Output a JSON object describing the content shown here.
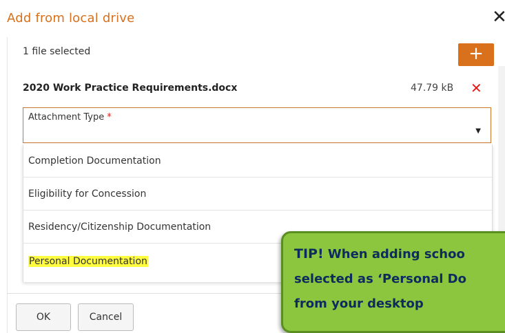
{
  "dialog": {
    "title": "Add from local drive",
    "close_glyph": "✕",
    "file_count": "1 file selected",
    "add_glyph": "+",
    "file": {
      "name": "2020 Work Practice Requirements.docx",
      "size": "47.79 kB",
      "remove_glyph": "✕"
    },
    "attachment_type": {
      "label": "Attachment Type",
      "required_mark": "*",
      "caret": "▼"
    },
    "options": [
      "Completion Documentation",
      "Eligibility for Concession",
      "Residency/Citizenship Documentation",
      "Personal Documentation"
    ],
    "buttons": {
      "ok": "OK",
      "cancel": "Cancel"
    }
  },
  "tip": {
    "prefix": "TIP!",
    "line1": "When adding schoo",
    "line2": "selected as ‘Personal Do",
    "line3": "from your desktop"
  },
  "colors": {
    "accent": "#d9701b",
    "remove": "#e01b1b",
    "highlight": "#fffc3f",
    "tip_bg": "#8cc63e",
    "tip_text": "#0d2b5c"
  },
  "icons": {
    "close": "close-icon",
    "add": "plus-icon",
    "remove": "remove-x-icon",
    "caret": "caret-down-icon"
  }
}
